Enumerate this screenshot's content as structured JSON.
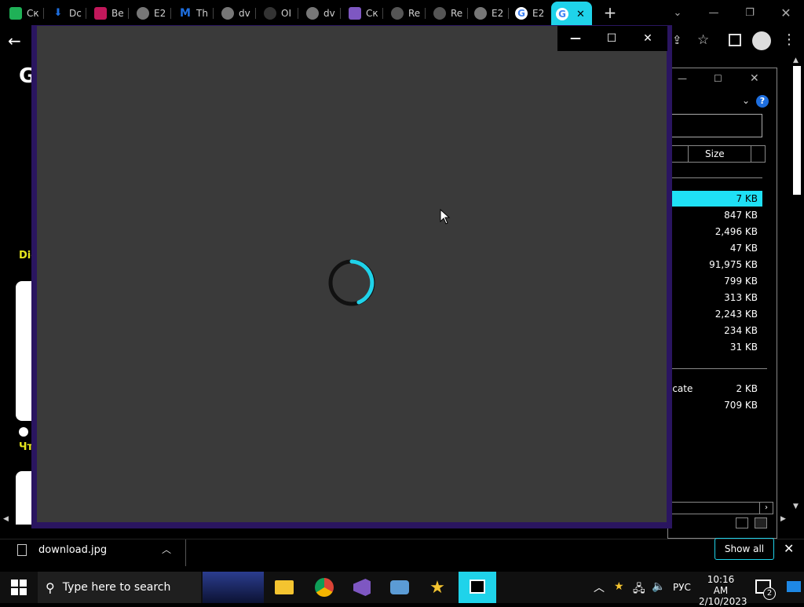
{
  "browser": {
    "tabs": [
      {
        "label": "Ск",
        "icon": "t-app-icon",
        "color": "#1fb157"
      },
      {
        "label": "Dc",
        "icon": "download-icon",
        "color": "#1e6fe0"
      },
      {
        "label": "Be",
        "icon": "app-icon",
        "color": "#c2185b"
      },
      {
        "label": "E2",
        "icon": "globe-icon",
        "color": "#888888"
      },
      {
        "label": "Th",
        "icon": "m-icon",
        "color": "#1e6fe0"
      },
      {
        "label": "dv",
        "icon": "globe-icon",
        "color": "#888888"
      },
      {
        "label": "OI",
        "icon": "lock-icon",
        "color": "#444444"
      },
      {
        "label": "dv",
        "icon": "globe-icon",
        "color": "#888888"
      },
      {
        "label": "Ск",
        "icon": "shield-icon",
        "color": "#7e57c2"
      },
      {
        "label": "Re",
        "icon": "cursor-icon",
        "color": "#888888"
      },
      {
        "label": "Re",
        "icon": "cursor-icon",
        "color": "#888888"
      },
      {
        "label": "E2",
        "icon": "globe-icon",
        "color": "#888888"
      },
      {
        "label": "E2",
        "icon": "google-icon",
        "color": "#ffffff"
      }
    ],
    "active_tab": {
      "label": "G",
      "close": "✕"
    },
    "new_tab": "+",
    "page_side_text": {
      "dic": "Dic",
      "cht": "Чт",
      "g": "G"
    }
  },
  "explorer": {
    "column_header": "Size",
    "sizes": [
      "7 KB",
      "847 KB",
      "2,496 KB",
      "47 KB",
      "91,975 KB",
      "799 KB",
      "313 KB",
      "2,243 KB",
      "234 KB",
      "31 KB"
    ],
    "lower_rows": [
      {
        "name": "icate",
        "size": "2 KB"
      },
      {
        "name": "",
        "size": "709 KB"
      }
    ],
    "highlight_color": "#1fe0f5"
  },
  "photos": {
    "controls": {
      "minimize": "—",
      "maximize": "☐",
      "close": "✕"
    },
    "spinner_color": "#1fd3ea"
  },
  "downloads": {
    "file": "download.jpg",
    "show_all": "Show all"
  },
  "taskbar": {
    "search_placeholder": "Type here to search",
    "language": "РУС",
    "time": "10:16 AM",
    "date": "2/10/2023",
    "notification_count": "2"
  }
}
